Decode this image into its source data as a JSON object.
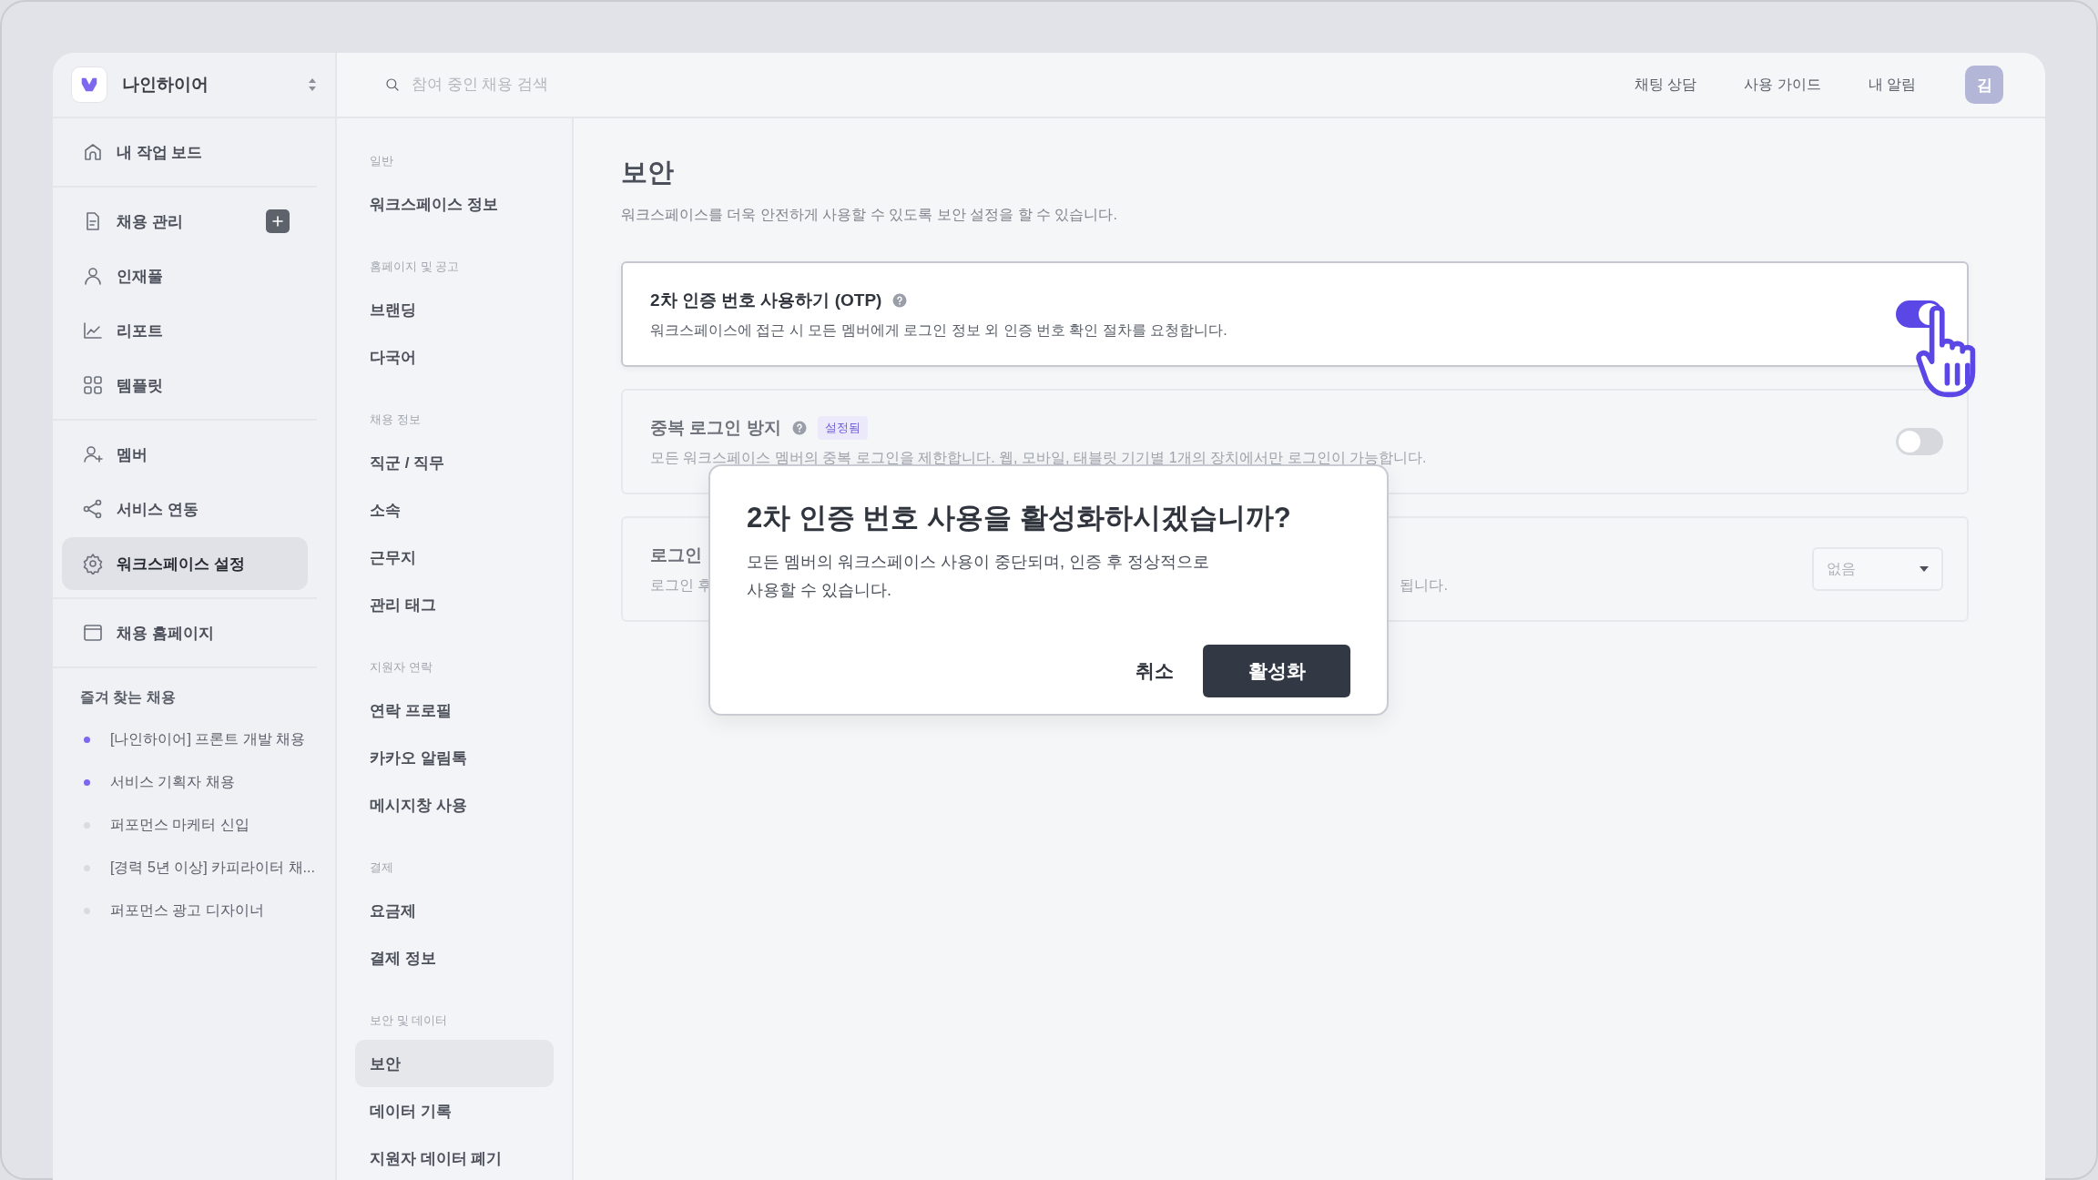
{
  "workspace": {
    "name": "나인하이어"
  },
  "nav_groups": [
    [
      {
        "label": "내 작업 보드",
        "selected": false
      }
    ],
    [
      {
        "label": "채용 관리",
        "selected": false,
        "add_button": true
      },
      {
        "label": "인재풀",
        "selected": false
      },
      {
        "label": "리포트",
        "selected": false
      },
      {
        "label": "템플릿",
        "selected": false
      }
    ],
    [
      {
        "label": "멤버",
        "selected": false
      },
      {
        "label": "서비스 연동",
        "selected": false
      },
      {
        "label": "워크스페이스 설정",
        "selected": true
      }
    ],
    [
      {
        "label": "채용 홈페이지",
        "selected": false
      }
    ]
  ],
  "favorites": {
    "title": "즐겨 찾는 채용",
    "items": [
      {
        "label": "[나인하이어] 프론트 개발 채용",
        "color": "#7b68ee"
      },
      {
        "label": "서비스 기획자 채용",
        "color": "#7b68ee"
      },
      {
        "label": "퍼포먼스 마케터 신입",
        "color": "#d9dbe1"
      },
      {
        "label": "[경력 5년 이상] 카피라이터 채...",
        "color": "#d9dbe1"
      },
      {
        "label": "퍼포먼스 광고 디자이너",
        "color": "#d9dbe1"
      }
    ]
  },
  "search": {
    "placeholder": "참여 중인 채용 검색"
  },
  "header_links": [
    "채팅 상담",
    "사용 가이드",
    "내 알림"
  ],
  "avatar": "김",
  "settings_nav": [
    {
      "heading": "일반",
      "items": [
        {
          "label": "워크스페이스 정보",
          "selected": false
        }
      ]
    },
    {
      "heading": "홈페이지 및 공고",
      "items": [
        {
          "label": "브랜딩",
          "selected": false
        },
        {
          "label": "다국어",
          "selected": false
        }
      ]
    },
    {
      "heading": "채용 정보",
      "items": [
        {
          "label": "직군 / 직무",
          "selected": false
        },
        {
          "label": "소속",
          "selected": false
        },
        {
          "label": "근무지",
          "selected": false
        },
        {
          "label": "관리 태그",
          "selected": false
        }
      ]
    },
    {
      "heading": "지원자 연락",
      "items": [
        {
          "label": "연락 프로필",
          "selected": false
        },
        {
          "label": "카카오 알림톡",
          "selected": false
        },
        {
          "label": "메시지창 사용",
          "selected": false
        }
      ]
    },
    {
      "heading": "결제",
      "items": [
        {
          "label": "요금제",
          "selected": false
        },
        {
          "label": "결제 정보",
          "selected": false
        }
      ]
    },
    {
      "heading": "보안 및 데이터",
      "items": [
        {
          "label": "보안",
          "selected": true
        },
        {
          "label": "데이터 기록",
          "selected": false
        },
        {
          "label": "지원자 데이터 폐기",
          "selected": false
        }
      ]
    }
  ],
  "page": {
    "title": "보안",
    "description": "워크스페이스를 더욱 안전하게 사용할 수 있도록 보안 설정을 할 수 있습니다.",
    "settings": [
      {
        "kind": "toggle",
        "title": "2차 인증 번호 사용하기 (OTP)",
        "help": true,
        "description": "워크스페이스에 접근 시 모든 멤버에게 로그인 정보 외 인증 번호 확인 절차를 요청합니다.",
        "on": true,
        "highlighted": true
      },
      {
        "kind": "toggle",
        "title": "중복 로그인 방지",
        "help": true,
        "badge": "설정됨",
        "description": "모든 워크스페이스 멤버의 중복 로그인을 제한합니다. 웹, 모바일, 태블릿 기기별 1개의 장치에서만 로그인이 가능합니다.",
        "on": false,
        "highlighted": false
      },
      {
        "kind": "select",
        "title": "로그인",
        "description": "로그인 후",
        "description_end": "됩니다.",
        "value": "없음",
        "highlighted": false
      }
    ]
  },
  "dialog": {
    "title": "2차 인증 번호 사용을 활성화하시겠습니까?",
    "message": "모든 멤버의 워크스페이스 사용이 중단되며, 인증 후 정상적으로\n사용할 수 있습니다.",
    "buttons": [
      {
        "label": "취소",
        "kind": "text"
      },
      {
        "label": "활성화",
        "kind": "primary"
      }
    ]
  }
}
